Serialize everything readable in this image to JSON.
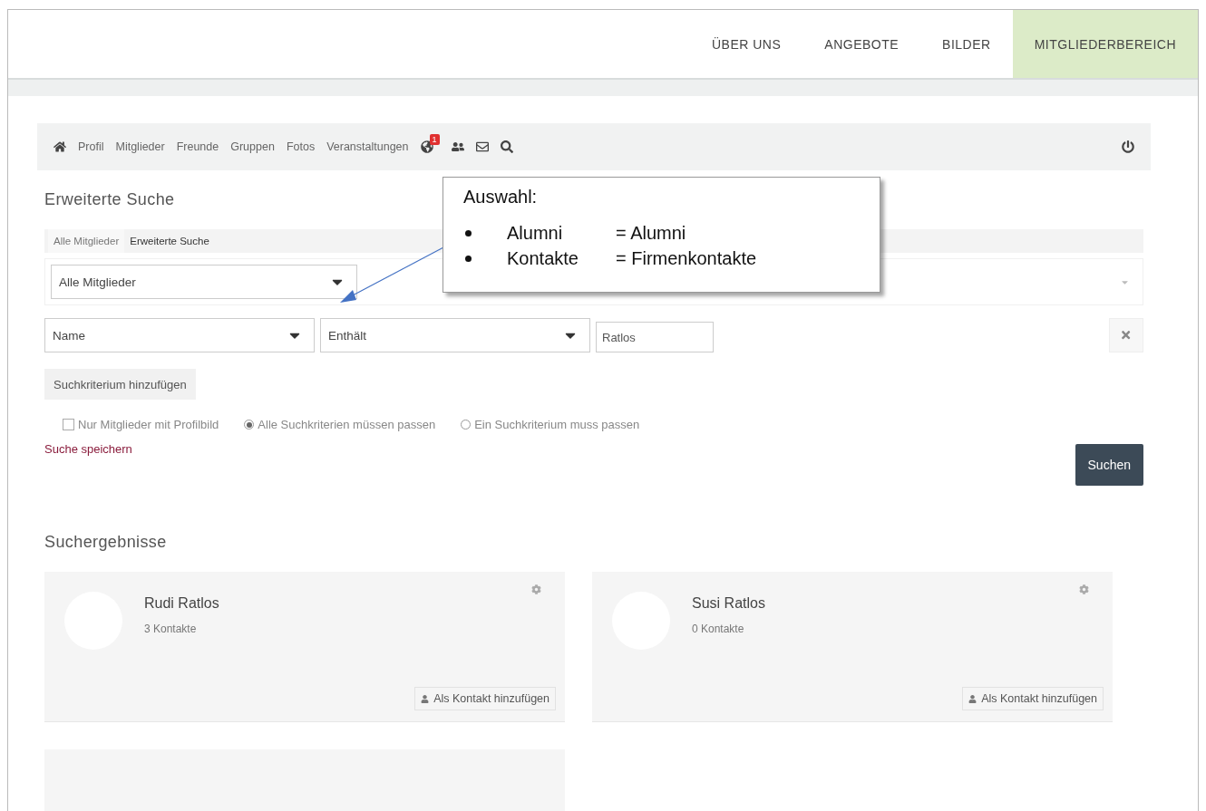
{
  "top_nav": [
    {
      "label": "ÜBER UNS",
      "selected": false
    },
    {
      "label": "ANGEBOTE",
      "selected": false
    },
    {
      "label": "BILDER",
      "selected": false
    },
    {
      "label": "MITGLIEDERBEREICH",
      "selected": true
    }
  ],
  "toolbar": {
    "items": [
      "Profil",
      "Mitglieder",
      "Freunde",
      "Gruppen",
      "Fotos",
      "Veranstaltungen"
    ],
    "notification_count": "1"
  },
  "page_title": "Erweiterte Suche",
  "breadcrumbs": [
    {
      "label": "Alle Mitglieder",
      "selected": false
    },
    {
      "label": "Erweiterte Suche",
      "selected": true
    }
  ],
  "member_type_select": {
    "value": "Alle Mitglieder"
  },
  "criterion": {
    "field": "Name",
    "operator": "Enthält",
    "value": "Ratlos"
  },
  "add_criterion": "Suchkriterium hinzufügen",
  "options": [
    {
      "kind": "checkbox",
      "label": "Nur Mitglieder mit Profilbild",
      "checked": false
    },
    {
      "kind": "radio",
      "label": "Alle Suchkriterien müssen passen",
      "selected": true
    },
    {
      "kind": "radio",
      "label": "Ein Suchkriterium muss passen",
      "selected": false
    }
  ],
  "save_search": "Suche speichern",
  "search_button": "Suchen",
  "results_title": "Suchergebnisse",
  "results": [
    {
      "name": "Rudi Ratlos",
      "contacts": "3 Kontakte",
      "action": "Als Kontakt hinzufügen"
    },
    {
      "name": "Susi Ratlos",
      "contacts": "0 Kontakte",
      "action": "Als Kontakt hinzufügen"
    }
  ],
  "callout": {
    "title": "Auswahl:",
    "lines": [
      {
        "term": "Alumni",
        "meaning": "= Alumni"
      },
      {
        "term": "Kontakte",
        "meaning": "= Firmenkontakte"
      }
    ]
  }
}
